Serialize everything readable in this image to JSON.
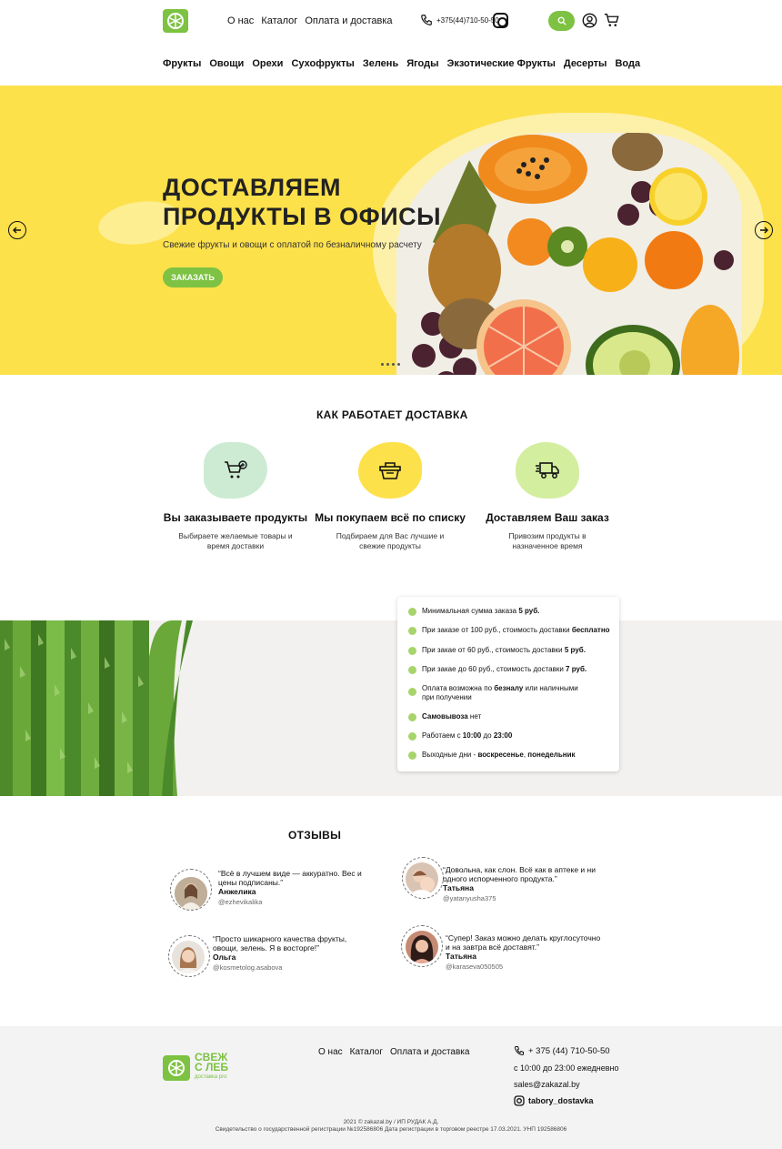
{
  "header": {
    "top_nav": [
      "О нас",
      "Каталог",
      "Оплата и доставка"
    ],
    "phone": "+375(44)710-50-50",
    "categories": [
      "Фрукты",
      "Овощи",
      "Орехи",
      "Сухофрукты",
      "Зелень",
      "Ягоды",
      "Экзотические Фрукты",
      "Десерты",
      "Вода"
    ]
  },
  "hero": {
    "title_line1": "ДОСТАВЛЯЕМ",
    "title_line2": "ПРОДУКТЫ В ОФИСЫ",
    "subtitle": "Свежие фрукты и овощи с оплатой по безналичному расчету",
    "button": "ЗАКАЗАТЬ"
  },
  "how": {
    "title": "КАК РАБОТАЕТ ДОСТАВКА",
    "steps": [
      {
        "title": "Вы заказываете продукты",
        "desc1": "Выбираете желаемые товары и",
        "desc2": "время доставки",
        "color": "#cdebd3"
      },
      {
        "title": "Мы покупаем всё по списку",
        "desc1": "Подбираем для Вас лучшие и",
        "desc2": "свежие продукты",
        "color": "#fde14b"
      },
      {
        "title": "Доставляем Ваш заказ",
        "desc1": "Привозим продукты в",
        "desc2": "назначенное время",
        "color": "#d3ee9f"
      }
    ]
  },
  "conditions": [
    {
      "a": "Минимальная сумма заказа ",
      "b": "5 руб.",
      "c": ""
    },
    {
      "a": "При заказе от 100 руб., стоимость доставки ",
      "b": "бесплатно",
      "c": ""
    },
    {
      "a": "При закае от 60 руб., стоимость доставки ",
      "b": "5 руб.",
      "c": ""
    },
    {
      "a": "При закае до 60 руб., стоимость доставки ",
      "b": "7 руб.",
      "c": ""
    },
    {
      "a": "Оплата возможна по ",
      "b": "безналу",
      "c": " или наличными при получении"
    },
    {
      "a": "",
      "b": "Самовывоза",
      "c": " нет"
    },
    {
      "a": "Работаем с ",
      "b": "10:00",
      "c": " до ",
      "d": "23:00"
    },
    {
      "a": "Выходные дни - ",
      "b": "воскресенье",
      "c": ", ",
      "d": "понедельник"
    }
  ],
  "reviews": {
    "title": "ОТЗЫВЫ",
    "items": [
      {
        "text": "“Всё в лучшем виде — аккуратно. Вес и цены подписаны.”",
        "name": "Анжелика",
        "handle": "@ezhevikalika"
      },
      {
        "text": "“Довольна, как слон. Всё как в аптеке и ни одного испорченного продукта.”",
        "name": "Татьяна",
        "handle": "@yatanyusha375"
      },
      {
        "text": "“Просто шикарного качества фрукты, овощи, зелень. Я в восторге!”",
        "name": "Ольга",
        "handle": "@kosmetolog.asabova"
      },
      {
        "text": "“Супер! Заказ можно делать круглосуточно и на завтра всё доставят.”",
        "name": "Татьяна",
        "handle": "@karaseva050505"
      }
    ]
  },
  "footer": {
    "logo_line1": "СВЕЖ",
    "logo_line2": "С ЛЕБ",
    "logo_sub": "доставка pro",
    "nav": [
      "О нас",
      "Каталог",
      "Оплата и доставка"
    ],
    "phone": "+ 375 (44) 710-50-50",
    "hours": "с 10:00 до 23:00 ежедневно",
    "email": "sales@zakazal.by",
    "instagram": "tabory_dostavka",
    "copyright1": "2021 © zakazal.by / ИП РУДАК А.Д.",
    "copyright2": "Свидетельство о государственной регистрации №192586806 Дата регистрации в торговом реестре 17.03.2021. УНП 192586806"
  }
}
